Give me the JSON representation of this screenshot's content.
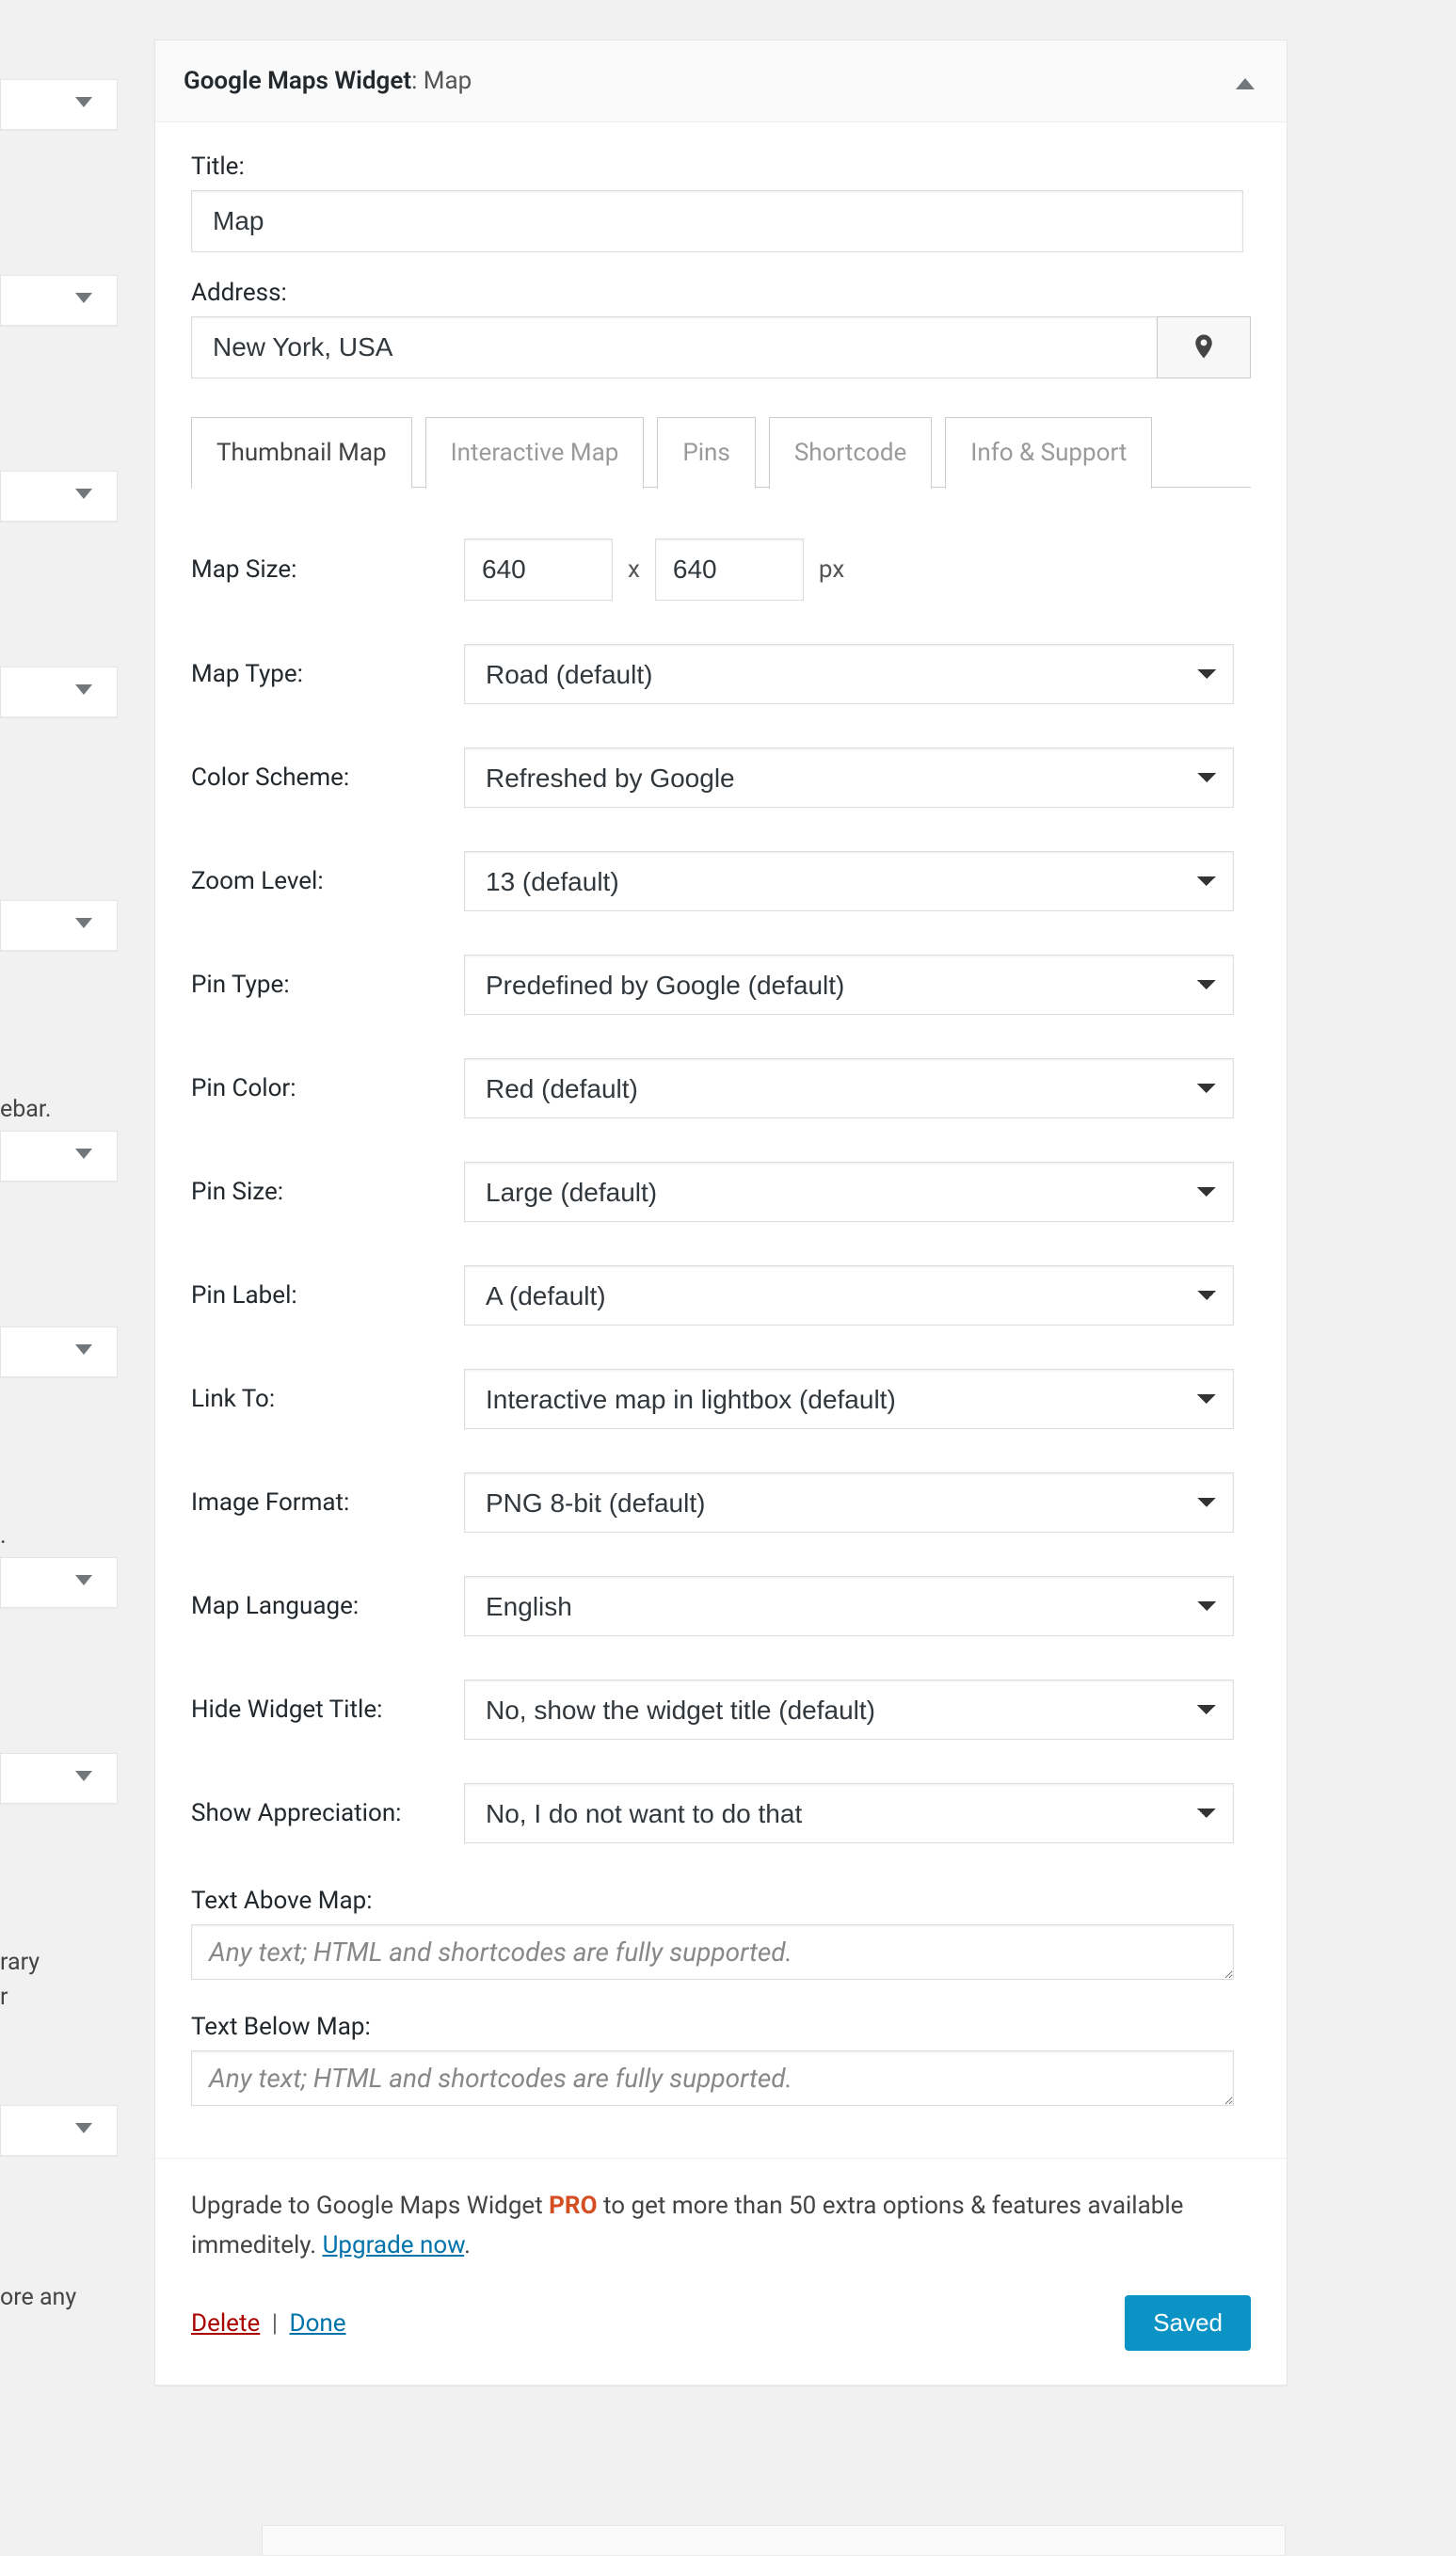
{
  "widget": {
    "header_name": "Google Maps Widget",
    "header_suffix": ": Map"
  },
  "labels": {
    "title": "Title:",
    "address": "Address:"
  },
  "fields": {
    "title_value": "Map",
    "address_value": "New York, USA"
  },
  "tabs": [
    "Thumbnail Map",
    "Interactive Map",
    "Pins",
    "Shortcode",
    "Info & Support"
  ],
  "settings": {
    "map_size": {
      "label": "Map Size:",
      "w": "640",
      "h": "640",
      "x": "x",
      "unit": "px"
    },
    "map_type": {
      "label": "Map Type:",
      "value": "Road (default)"
    },
    "color_scheme": {
      "label": "Color Scheme:",
      "value": "Refreshed by Google"
    },
    "zoom_level": {
      "label": "Zoom Level:",
      "value": "13 (default)"
    },
    "pin_type": {
      "label": "Pin Type:",
      "value": "Predefined by Google (default)"
    },
    "pin_color": {
      "label": "Pin Color:",
      "value": "Red (default)"
    },
    "pin_size": {
      "label": "Pin Size:",
      "value": "Large (default)"
    },
    "pin_label": {
      "label": "Pin Label:",
      "value": "A (default)"
    },
    "link_to": {
      "label": "Link To:",
      "value": "Interactive map in lightbox (default)"
    },
    "image_format": {
      "label": "Image Format:",
      "value": "PNG 8-bit (default)"
    },
    "map_language": {
      "label": "Map Language:",
      "value": "English"
    },
    "hide_title": {
      "label": "Hide Widget Title:",
      "value": "No, show the widget title (default)"
    },
    "show_appreciation": {
      "label": "Show Appreciation:",
      "value": "No, I do not want to do that"
    },
    "text_above": {
      "label": "Text Above Map:",
      "placeholder": "Any text; HTML and shortcodes are fully supported."
    },
    "text_below": {
      "label": "Text Below Map:",
      "placeholder": "Any text; HTML and shortcodes are fully supported."
    }
  },
  "footer": {
    "promo_pre": "Upgrade to Google Maps Widget ",
    "promo_pro": "PRO",
    "promo_post": " to get more than 50 extra options & features available immeditely. ",
    "upgrade_link": "Upgrade now",
    "period": ".",
    "delete": "Delete",
    "sep": " | ",
    "done": "Done",
    "saved": "Saved"
  },
  "side_fragments": [
    "ebar.",
    ".",
    "rary",
    "r",
    "ore any"
  ]
}
